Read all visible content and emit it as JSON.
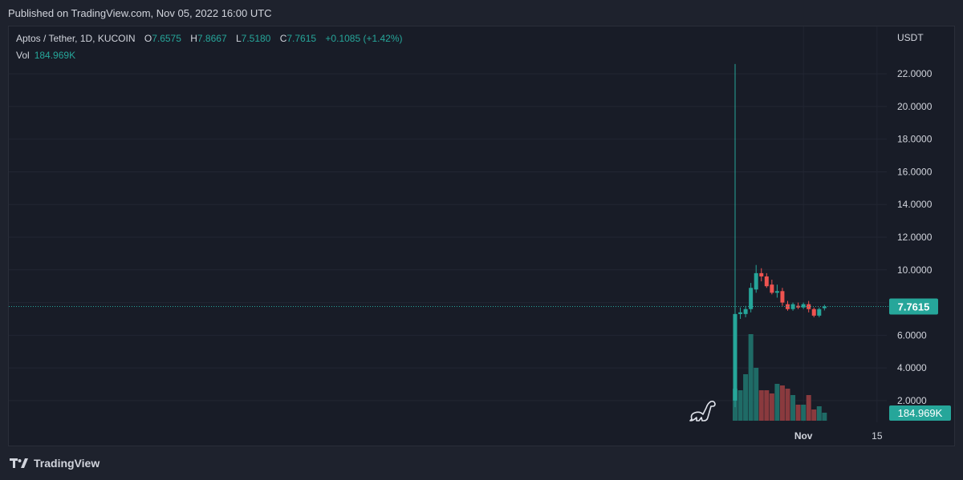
{
  "header": {
    "published": "Published on TradingView.com, Nov 05, 2022 16:00 UTC"
  },
  "legend": {
    "symbol": "Aptos / Tether, 1D, KUCOIN",
    "o_label": "O",
    "o_value": "7.6575",
    "h_label": "H",
    "h_value": "7.8667",
    "l_label": "L",
    "l_value": "7.5180",
    "c_label": "C",
    "c_value": "7.7615",
    "change": "+0.1085 (+1.42%)",
    "vol_label": "Vol",
    "vol_value": "184.969K"
  },
  "price_axis": {
    "currency": "USDT",
    "last_price_label": "7.7615",
    "last_volume_label": "184.969K"
  },
  "time_axis": {
    "labels": [
      "Nov",
      "15"
    ]
  },
  "footer": {
    "brand": "TradingView"
  },
  "colors": {
    "up": "#26a69a",
    "down": "#ef5350",
    "up_volume": "#1f6b66",
    "down_volume": "#8a3a3e",
    "background": "#181c27",
    "grid": "#222633"
  },
  "chart_data": {
    "type": "candlestick",
    "title": "Aptos / Tether, 1D, KUCOIN",
    "ylabel": "USDT",
    "ylim": [
      0,
      23.5
    ],
    "y_ticks": [
      2,
      4,
      6,
      8,
      10,
      12,
      14,
      16,
      18,
      20,
      22
    ],
    "grid": true,
    "x_ticks": [
      {
        "label": "Nov",
        "index": 13
      },
      {
        "label": "15",
        "index": 27
      }
    ],
    "last_price": 7.7615,
    "candles": [
      {
        "o": 2.0,
        "h": 22.6,
        "l": 1.6,
        "c": 7.3,
        "v": 2.0
      },
      {
        "o": 7.3,
        "h": 7.7,
        "l": 7.0,
        "c": 7.4,
        "v": 1.9
      },
      {
        "o": 7.3,
        "h": 7.8,
        "l": 7.1,
        "c": 7.6,
        "v": 2.9
      },
      {
        "o": 7.6,
        "h": 9.2,
        "l": 7.4,
        "c": 8.9,
        "v": 5.4
      },
      {
        "o": 8.8,
        "h": 10.3,
        "l": 8.6,
        "c": 9.8,
        "v": 3.3
      },
      {
        "o": 9.8,
        "h": 10.1,
        "l": 9.3,
        "c": 9.6,
        "v": 1.9
      },
      {
        "o": 9.6,
        "h": 9.8,
        "l": 8.9,
        "c": 9.0,
        "v": 1.9
      },
      {
        "o": 9.1,
        "h": 9.4,
        "l": 8.5,
        "c": 8.6,
        "v": 1.7
      },
      {
        "o": 8.6,
        "h": 9.1,
        "l": 8.3,
        "c": 8.7,
        "v": 2.3
      },
      {
        "o": 8.7,
        "h": 8.9,
        "l": 7.8,
        "c": 8.0,
        "v": 2.2
      },
      {
        "o": 7.9,
        "h": 8.1,
        "l": 7.5,
        "c": 7.6,
        "v": 2.0
      },
      {
        "o": 7.6,
        "h": 8.0,
        "l": 7.5,
        "c": 7.9,
        "v": 1.6
      },
      {
        "o": 7.8,
        "h": 8.0,
        "l": 7.6,
        "c": 7.7,
        "v": 1.0
      },
      {
        "o": 7.7,
        "h": 8.0,
        "l": 7.6,
        "c": 7.9,
        "v": 1.0
      },
      {
        "o": 7.9,
        "h": 8.1,
        "l": 7.4,
        "c": 7.6,
        "v": 1.6
      },
      {
        "o": 7.6,
        "h": 7.7,
        "l": 7.1,
        "c": 7.2,
        "v": 0.7
      },
      {
        "o": 7.2,
        "h": 7.7,
        "l": 7.1,
        "c": 7.6,
        "v": 0.9
      },
      {
        "o": 7.6575,
        "h": 7.8667,
        "l": 7.518,
        "c": 7.7615,
        "v": 0.5
      }
    ]
  }
}
